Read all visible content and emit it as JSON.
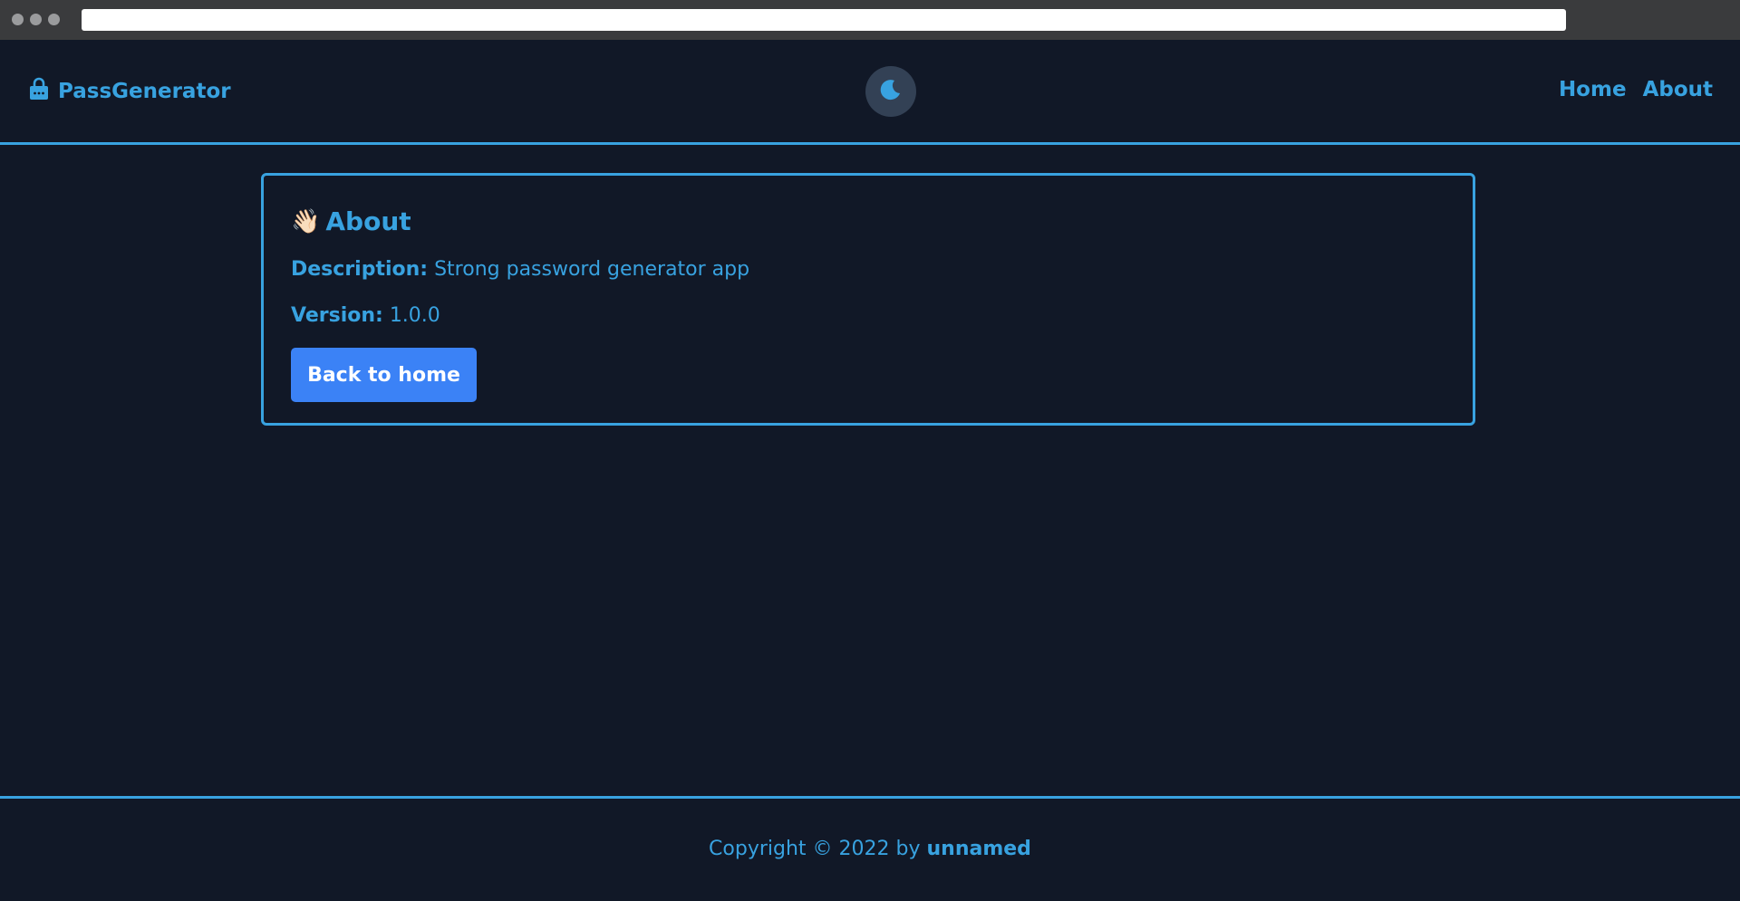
{
  "colors": {
    "background": "#111827",
    "accent": "#38a2e0",
    "button": "#3b82f6",
    "toggle_bg": "#334155"
  },
  "header": {
    "brand_icon": "lock-icon",
    "brand": "PassGenerator",
    "theme_toggle_icon": "moon-icon",
    "nav": {
      "home": "Home",
      "about": "About"
    }
  },
  "about": {
    "title_icon": "waving-hand-icon",
    "title_emoji": "👋🏻",
    "title": "About",
    "description_label": "Description:",
    "description_value": "Strong password generator app",
    "version_label": "Version:",
    "version_value": "1.0.0",
    "back_button": "Back to home"
  },
  "footer": {
    "copyright": "Copyright © 2022 by",
    "author": "unnamed"
  }
}
